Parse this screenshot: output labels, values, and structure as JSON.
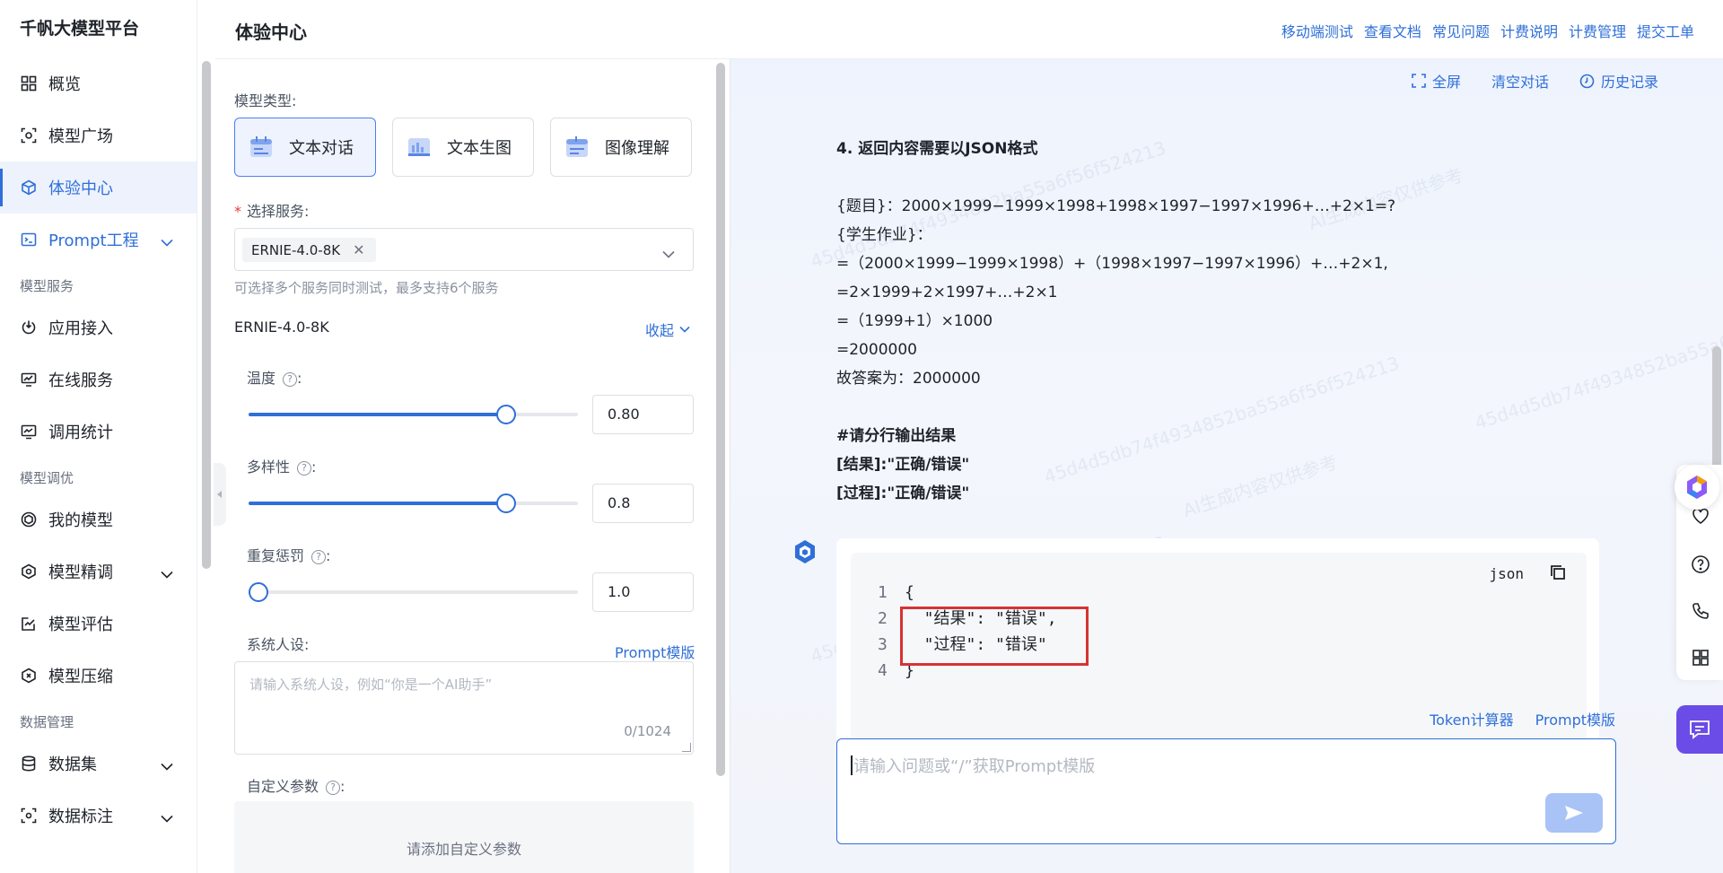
{
  "brand": "千帆大模型平台",
  "sidebar": {
    "items": [
      {
        "label": "概览"
      },
      {
        "label": "模型广场"
      },
      {
        "label": "体验中心"
      },
      {
        "label": "Prompt工程"
      },
      {
        "section": "模型服务"
      },
      {
        "label": "应用接入"
      },
      {
        "label": "在线服务"
      },
      {
        "label": "调用统计"
      },
      {
        "section": "模型调优"
      },
      {
        "label": "我的模型"
      },
      {
        "label": "模型精调"
      },
      {
        "label": "模型评估"
      },
      {
        "label": "模型压缩"
      },
      {
        "section": "数据管理"
      },
      {
        "label": "数据集"
      },
      {
        "label": "数据标注"
      }
    ]
  },
  "header": {
    "title": "体验中心",
    "links": [
      "移动端测试",
      "查看文档",
      "常见问题",
      "计费说明",
      "计费管理",
      "提交工单"
    ]
  },
  "config": {
    "model_type_label": "模型类型:",
    "model_types": [
      "文本对话",
      "文本生图",
      "图像理解"
    ],
    "select_service_label": "选择服务:",
    "selected_tag": "ERNIE-4.0-8K",
    "tag_close": "✕",
    "hint": "可选择多个服务同时测试，最多支持6个服务",
    "model_name": "ERNIE-4.0-8K",
    "collapse_label": "收起",
    "temperature_label": "温度",
    "temperature_value": "0.80",
    "temperature_fraction": 0.8,
    "diversity_label": "多样性",
    "diversity_value": "0.8",
    "diversity_fraction": 0.8,
    "penalty_label": "重复惩罚",
    "penalty_value": "1.0",
    "penalty_fraction": 0.0,
    "qmark": "?",
    "colon": ":",
    "system_label": "系统人设:",
    "prompt_template": "Prompt模版",
    "system_placeholder": "请输入系统人设，例如“你是一个AI助手”",
    "system_counter": "0/1024",
    "custom_params_label": "自定义参数",
    "custom_params_empty": "请添加自定义参数"
  },
  "chat": {
    "tools": [
      "全屏",
      "清空对话",
      "历史记录"
    ],
    "message_lines": [
      {
        "text": "4. 返回内容需要以JSON格式",
        "bold": true
      },
      {
        "text": "",
        "bold": false
      },
      {
        "text": "{题目}：2000×1999−1999×1998+1998×1997−1997×1996+…+2×1=?",
        "bold": false
      },
      {
        "text": "{学生作业}：",
        "bold": false
      },
      {
        "text": "=（2000×1999−1999×1998）+（1998×1997−1997×1996）+…+2×1,",
        "bold": false
      },
      {
        "text": "=2×1999+2×1997+…+2×1",
        "bold": false
      },
      {
        "text": "=（1999+1）×1000",
        "bold": false
      },
      {
        "text": "=2000000",
        "bold": false
      },
      {
        "text": "故答案为：2000000",
        "bold": false
      },
      {
        "text": "",
        "bold": false
      },
      {
        "text": "#请分行输出结果",
        "bold": true
      },
      {
        "text": "[结果]:\"正确/错误\"",
        "bold": true
      },
      {
        "text": "[过程]:\"正确/错误\"",
        "bold": true
      }
    ],
    "code_lang": "json",
    "code_lines": [
      {
        "n": "1",
        "code": "{"
      },
      {
        "n": "2",
        "code": "  \"结果\": \"错误\","
      },
      {
        "n": "3",
        "code": "  \"过程\": \"错误\""
      },
      {
        "n": "4",
        "code": "}"
      }
    ],
    "links": [
      "Token计算器",
      "Prompt模版"
    ],
    "input_placeholder": "请输入问题或“/”获取Prompt模版",
    "watermarks": [
      "45d4d5db74f4934852ba55a6f56f524213",
      "AI生成内容仅供参考"
    ]
  },
  "colors": {
    "accent": "#2f6fd8",
    "highlight": "#d63333",
    "fab": "#6b4ce6"
  }
}
